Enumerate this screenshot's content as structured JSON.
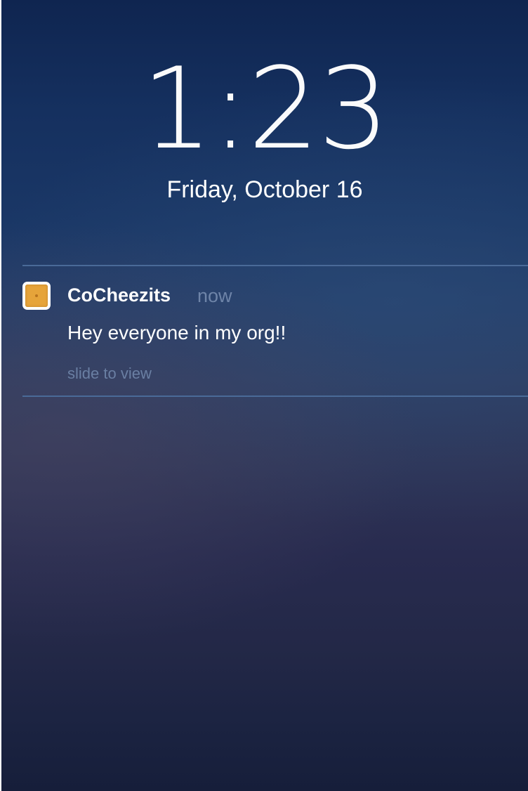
{
  "lock_screen": {
    "time": "1:23",
    "date": "Friday, October 16"
  },
  "notification": {
    "app_icon": "cheez-it-cracker-icon",
    "app_name": "CoCheezits",
    "time_ago": "now",
    "message": "Hey everyone in my org!!",
    "action_hint": "slide to view"
  },
  "colors": {
    "background_top": "#0f2550",
    "background_bottom": "#161e3a",
    "divider": "#4a6a98",
    "muted_text": "#6e84a8",
    "cracker": "#e6a43a"
  }
}
